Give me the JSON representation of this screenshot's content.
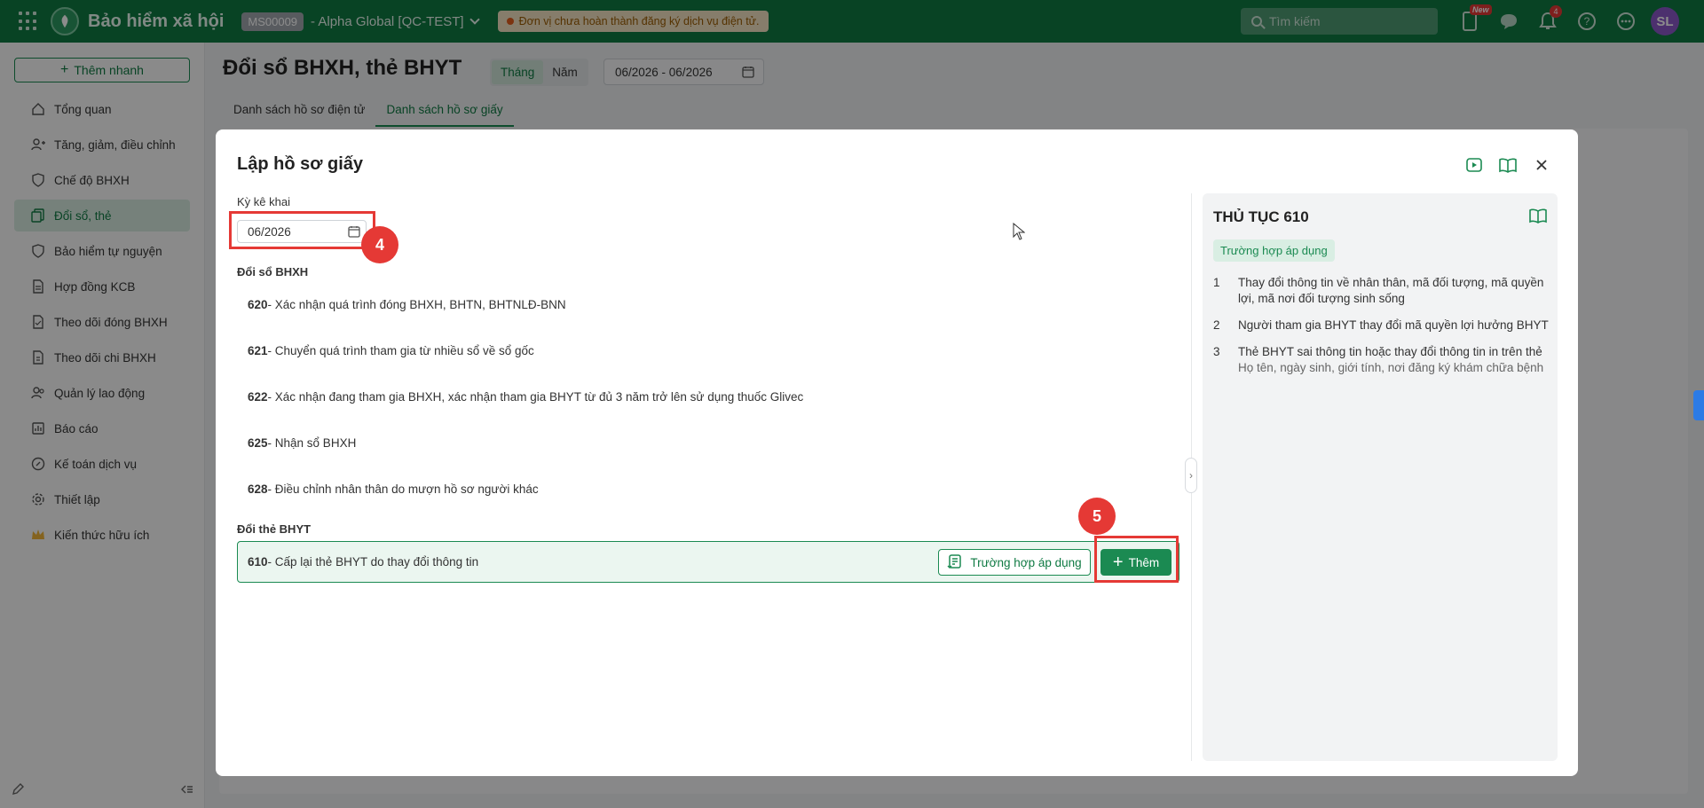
{
  "app": {
    "title": "Bảo hiểm xã hội",
    "tenant_code": "MS00009",
    "tenant_name": "- Alpha Global [QC-TEST]",
    "warning": "Đơn vị chưa hoàn thành đăng ký dịch vụ điện tử.",
    "search_placeholder": "Tìm kiếm",
    "new_badge": "New",
    "notification_count": "4",
    "avatar_initials": "SL"
  },
  "sidebar": {
    "quick_add": "Thêm nhanh",
    "items": [
      {
        "label": "Tổng quan"
      },
      {
        "label": "Tăng, giảm, điều chỉnh"
      },
      {
        "label": "Chế độ BHXH"
      },
      {
        "label": "Đổi sổ, thẻ"
      },
      {
        "label": "Bảo hiểm tự nguyện"
      },
      {
        "label": "Hợp đồng KCB"
      },
      {
        "label": "Theo dõi đóng BHXH"
      },
      {
        "label": "Theo dõi chi BHXH"
      },
      {
        "label": "Quản lý lao động"
      },
      {
        "label": "Báo cáo"
      },
      {
        "label": "Kế toán dịch vụ"
      },
      {
        "label": "Thiết lập"
      },
      {
        "label": "Kiến thức hữu ích"
      }
    ]
  },
  "page": {
    "title": "Đổi sổ BHXH, thẻ BHYT",
    "period_month": "Tháng",
    "period_year": "Năm",
    "date_range": "06/2026 - 06/2026",
    "tabs": [
      "Danh sách hồ sơ điện tử",
      "Danh sách hồ sơ giấy"
    ]
  },
  "modal": {
    "title": "Lập hồ sơ giấy",
    "period_label": "Kỳ kê khai",
    "period_value": "06/2026",
    "step_4": "4",
    "step_5": "5",
    "section_bhxh": "Đổi sổ BHXH",
    "bhxh_procs": [
      {
        "code": "620",
        "name": "- Xác nhận quá trình đóng BHXH, BHTN, BHTNLĐ-BNN"
      },
      {
        "code": "621",
        "name": "- Chuyển quá trình tham gia từ nhiều sổ về sổ gốc"
      },
      {
        "code": "622",
        "name": "- Xác nhận đang tham gia BHXH, xác nhận tham gia BHYT từ đủ 3 năm trở lên sử dụng thuốc Glivec"
      },
      {
        "code": "625",
        "name": "- Nhận sổ BHXH"
      },
      {
        "code": "628",
        "name": "- Điều chỉnh nhân thân do mượn hồ sơ người khác"
      }
    ],
    "section_bhyt": "Đổi thẻ BHYT",
    "bhyt_proc": {
      "code": "610",
      "name": "- Cấp lại thẻ BHYT do thay đổi thông tin"
    },
    "case_button": "Trường hợp áp dụng",
    "add_button": "Thêm"
  },
  "info_panel": {
    "title": "THỦ TỤC 610",
    "tag": "Trường hợp áp dụng",
    "items": [
      {
        "n": "1",
        "text": "Thay đổi thông tin về nhân thân, mã đối tượng, mã quyền lợi, mã nơi đối tượng sinh sống",
        "sub": ""
      },
      {
        "n": "2",
        "text": "Người tham gia BHYT thay đổi mã quyền lợi hưởng BHYT",
        "sub": ""
      },
      {
        "n": "3",
        "text": "Thẻ BHYT sai thông tin hoặc thay đổi thông tin in trên thẻ",
        "sub": "Họ tên, ngày sinh, giới tính, nơi đăng ký khám chữa bệnh"
      }
    ]
  },
  "colors": {
    "brand_green": "#0f7a43",
    "accent_green": "#1b8a52",
    "highlight_red": "#e53935"
  }
}
